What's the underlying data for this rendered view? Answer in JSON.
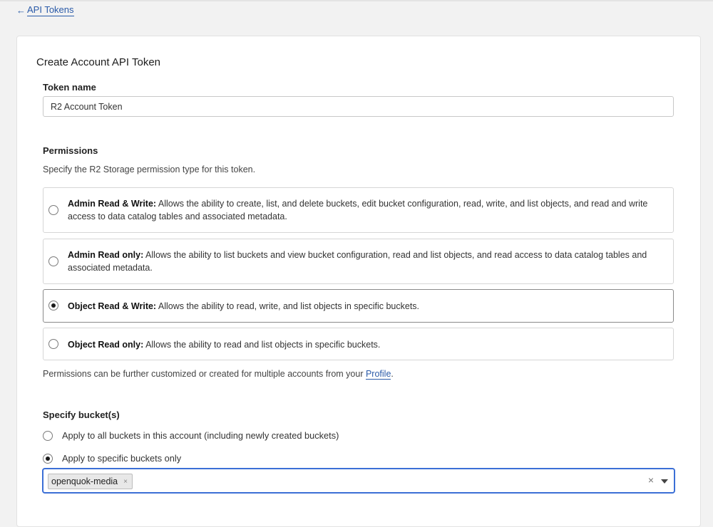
{
  "nav": {
    "back_arrow": "←",
    "back_label": "API Tokens"
  },
  "form": {
    "title": "Create Account API Token",
    "token_name_label": "Token name",
    "token_name_value": "R2 Account Token"
  },
  "permissions": {
    "label": "Permissions",
    "description": "Specify the R2 Storage permission type for this token.",
    "options": [
      {
        "title": "Admin Read & Write:",
        "text": " Allows the ability to create, list, and delete buckets, edit bucket configuration, read, write, and list objects, and read and write access to data catalog tables and associated metadata.",
        "selected": false
      },
      {
        "title": "Admin Read only:",
        "text": " Allows the ability to list buckets and view bucket configuration, read and list objects, and read access to data catalog tables and associated metadata.",
        "selected": false
      },
      {
        "title": "Object Read & Write:",
        "text": " Allows the ability to read, write, and list objects in specific buckets.",
        "selected": true
      },
      {
        "title": "Object Read only:",
        "text": " Allows the ability to read and list objects in specific buckets.",
        "selected": false
      }
    ],
    "footer_text": "Permissions can be further customized or created for multiple accounts from your ",
    "footer_link": "Profile",
    "footer_end": "."
  },
  "buckets": {
    "label": "Specify bucket(s)",
    "options": [
      {
        "label": "Apply to all buckets in this account (including newly created buckets)",
        "selected": false
      },
      {
        "label": "Apply to specific buckets only",
        "selected": true
      }
    ],
    "selected_chip": "openquok-media",
    "chip_remove": "×",
    "clear_icon": "×"
  },
  "colors": {
    "link": "#2a5aa8",
    "focus_border": "#3b6fd6"
  }
}
